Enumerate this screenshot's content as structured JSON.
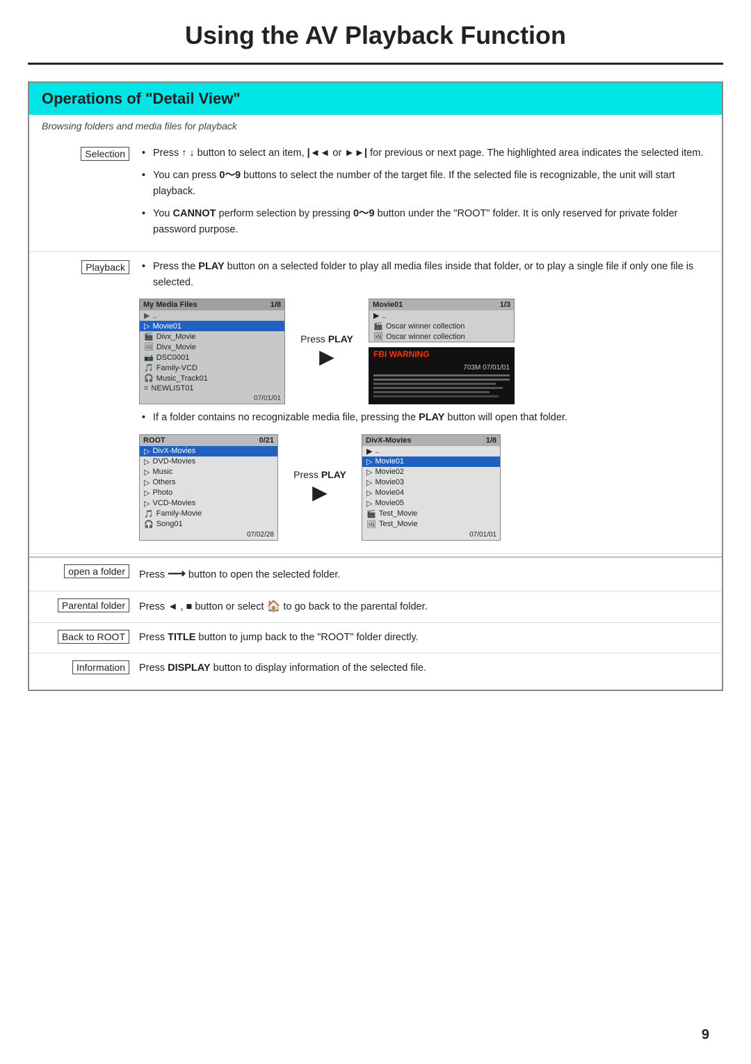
{
  "page": {
    "title": "Using the AV Playback Function",
    "page_number": "9"
  },
  "section": {
    "header": "Operations of \"Detail View\"",
    "subtitle": "Browsing folders and media files for playback"
  },
  "selection": {
    "label": "Selection",
    "bullets": [
      "Press ↑ ↓ button to select an item, |◄◄ or ►►| for previous or next page. The highlighted area indicates the selected item.",
      "You can press 0~9 buttons to select the number of the target file. If the selected file is recognizable, the unit will start playback.",
      "You CANNOT perform selection by pressing 0~9 button under the \"ROOT\" folder. It is only reserved for private folder password purpose."
    ]
  },
  "playback": {
    "label": "Playback",
    "bullet": "Press the PLAY button on a selected folder to play all media files inside that folder, or to play a single file if only one file is selected.",
    "no_media_bullet": "If a folder contains no recognizable media file, pressing the PLAY button will open that folder.",
    "press_play_label": "Press PLAY",
    "left_panel": {
      "title": "My Media Files",
      "count": "1/8",
      "items": [
        {
          "type": "up",
          "name": ".."
        },
        {
          "type": "folder",
          "name": "Movie01",
          "selected": true
        },
        {
          "type": "dvd",
          "name": "Divx_Movie"
        },
        {
          "type": "img",
          "name": "Divx_Movie"
        },
        {
          "type": "dvd",
          "name": "DSC0001"
        },
        {
          "type": "music",
          "name": "Family-VCD"
        },
        {
          "type": "dvd",
          "name": "Music_Track01"
        },
        {
          "type": "file",
          "name": "NEWLIST01"
        }
      ],
      "date": "07/01/01"
    },
    "right_top_panel": {
      "title": "Movie01",
      "count": "1/3",
      "items": [
        {
          "type": "up",
          "name": ".."
        },
        {
          "type": "dvd",
          "name": "Oscar winner collection"
        },
        {
          "type": "img",
          "name": "Oscar winner collection"
        }
      ]
    },
    "fbi_warning": "FBI WARNING",
    "right_info": "703M 07/01/01",
    "root_panel": {
      "title": "ROOT",
      "count": "0/21",
      "items": [
        {
          "type": "folder",
          "name": "DivX-Movies",
          "selected": true
        },
        {
          "type": "folder",
          "name": "DVD-Movies"
        },
        {
          "type": "folder",
          "name": "Music"
        },
        {
          "type": "folder",
          "name": "Others"
        },
        {
          "type": "folder",
          "name": "Photo"
        },
        {
          "type": "folder",
          "name": "VCD-Movies"
        },
        {
          "type": "music",
          "name": "Family-Movie"
        },
        {
          "type": "dvd",
          "name": "Song01"
        }
      ],
      "date": "07/02/28"
    },
    "divx_panel": {
      "title": "DivX-Movies",
      "count": "1/8",
      "items": [
        {
          "type": "up",
          "name": ".."
        },
        {
          "type": "folder",
          "name": "Movie01",
          "selected": true
        },
        {
          "type": "folder",
          "name": "Movie02"
        },
        {
          "type": "folder",
          "name": "Movie03"
        },
        {
          "type": "folder",
          "name": "Movie04"
        },
        {
          "type": "folder",
          "name": "Movie05"
        },
        {
          "type": "dvd",
          "name": "Test_Movie"
        },
        {
          "type": "img",
          "name": "Test_Movie"
        }
      ],
      "date": "07/01/01"
    }
  },
  "open_folder": {
    "label": "open a folder",
    "desc": "Press ➜ button to open the selected folder."
  },
  "parental_folder": {
    "label": "Parental folder",
    "desc": "Press ◄ , ■ button or select 🏠 to go back to the parental folder."
  },
  "back_to_root": {
    "label": "Back to ROOT",
    "desc": "Press TITLE button to jump back to the \"ROOT\" folder directly."
  },
  "information": {
    "label": "Information",
    "desc": "Press DISPLAY button to display information of the selected file."
  }
}
